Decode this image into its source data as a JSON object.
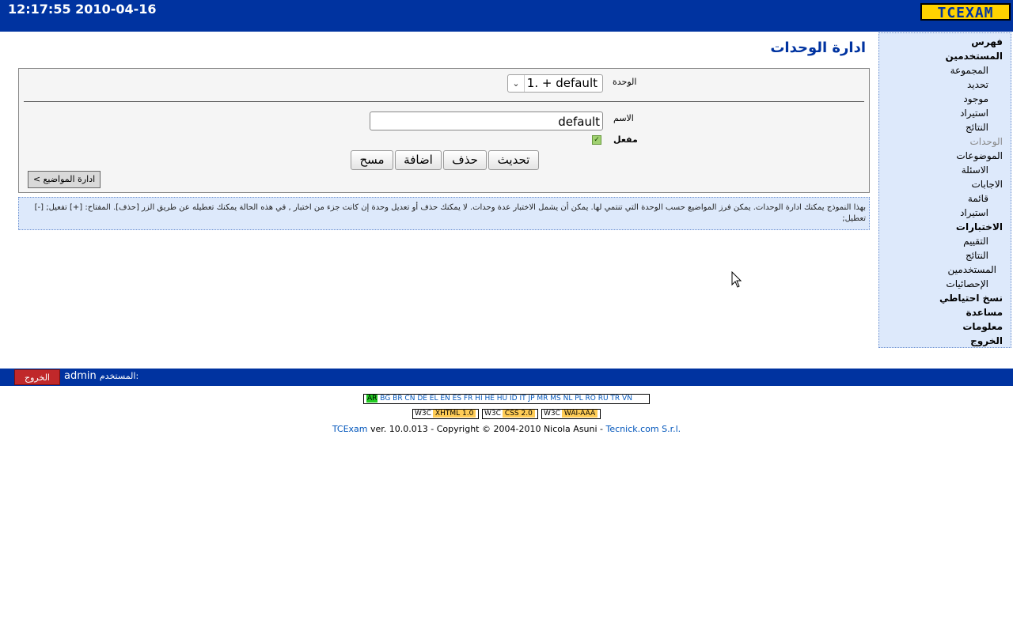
{
  "header": {
    "datetime": "12:17:55 2010-04-16",
    "logo": "TCEXAM"
  },
  "sidebar": {
    "items": [
      {
        "label": "فهرس",
        "style": "bold"
      },
      {
        "label": "المستخدمين",
        "style": "bold"
      },
      {
        "label": "المجموعة",
        "style": "sub"
      },
      {
        "label": "تحديد",
        "style": "sub"
      },
      {
        "label": "موجود",
        "style": "sub"
      },
      {
        "label": "استيراد",
        "style": "sub"
      },
      {
        "label": "النتائج",
        "style": "sub"
      },
      {
        "label": "الوحدات",
        "style": "current"
      },
      {
        "label": "الموضوعات",
        "style": "sub"
      },
      {
        "label": "الاسئلة",
        "style": "sub"
      },
      {
        "label": "الاجابات",
        "style": "sub"
      },
      {
        "label": "قائمة",
        "style": "sub"
      },
      {
        "label": "استيراد",
        "style": "sub"
      },
      {
        "label": "الاختبارات",
        "style": "bold"
      },
      {
        "label": "التقييم",
        "style": "sub"
      },
      {
        "label": "النتائج",
        "style": "sub"
      },
      {
        "label": "المستخدمين",
        "style": "sub"
      },
      {
        "label": "الإحصائيات",
        "style": "sub"
      },
      {
        "label": "نسخ احتياطي",
        "style": "bold"
      },
      {
        "label": "مساعدة",
        "style": "bold"
      },
      {
        "label": "معلومات",
        "style": "bold"
      },
      {
        "label": "الخروج",
        "style": "bold"
      }
    ]
  },
  "page": {
    "title": "ادارة الوحدات"
  },
  "form": {
    "unit_label": "الوحدة",
    "unit_selected": "1. + default",
    "name_label": "الاسم",
    "name_value": "default",
    "enabled_label": "مفعل",
    "enabled": true,
    "buttons": {
      "update": "تحديث",
      "delete": "حذف",
      "add": "اضافة",
      "clear": "مسح"
    },
    "goto_subjects": "ادارة المواضيع >"
  },
  "help": {
    "text": "بهذا النموذج يمكنك ادارة الوحدات. يمكن فرز المواضيع حسب الوحدة التي تنتمي لها. يمكن أن يشمل الاختبار عدة وحدات. لا يمكنك حذف أو تعديل وحدة إن كانت جزء من اختبار , في هذه الحالة يمكنك تعطيله عن طريق الزر [حذف]. المفتاح: [+] تفعيل; [-] تعطيل;"
  },
  "userbar": {
    "logout": "الخروج",
    "user_label": "المستخدم:",
    "username": "admin"
  },
  "footer": {
    "active_lang": "AR",
    "langs": "BG BR CN DE EL EN ES FR HI HE HU ID IT JP MR MS NL PL RO RU TR VN",
    "w3c": [
      {
        "k": "W3C",
        "v": "XHTML 1.0"
      },
      {
        "k": "W3C",
        "v": "CSS 2.0"
      },
      {
        "k": "W3C",
        "v": "WAI-AAA"
      }
    ],
    "app_link": "TCExam",
    "copyright": " ver. 10.0.013 - Copyright © 2004-2010 Nicola Asuni - ",
    "company_link": "Tecnick.com S.r.l."
  }
}
